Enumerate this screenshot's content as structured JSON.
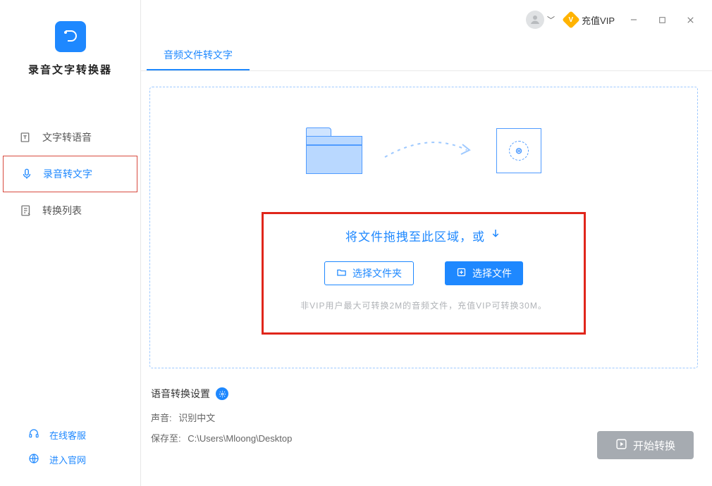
{
  "app_title": "录音文字转换器",
  "sidebar": {
    "items": [
      {
        "label": "文字转语音",
        "icon": "text-to-speech-icon"
      },
      {
        "label": "录音转文字",
        "icon": "mic-icon"
      },
      {
        "label": "转换列表",
        "icon": "list-icon"
      }
    ],
    "footer": {
      "support": "在线客服",
      "website": "进入官网"
    }
  },
  "titlebar": {
    "vip_label": "充值VIP",
    "vip_badge_letter": "V"
  },
  "tab": {
    "active_label": "音频文件转文字"
  },
  "dropzone": {
    "hint": "将文件拖拽至此区域，或",
    "select_folder": "选择文件夹",
    "select_file": "选择文件",
    "note": "非VIP用户最大可转换2M的音频文件，充值VIP可转换30M。"
  },
  "settings": {
    "title": "语音转换设置",
    "voice_label": "声音:",
    "voice_value": "识别中文",
    "save_label": "保存至:",
    "save_value": "C:\\Users\\Mloong\\Desktop"
  },
  "start_btn": "开始转换"
}
